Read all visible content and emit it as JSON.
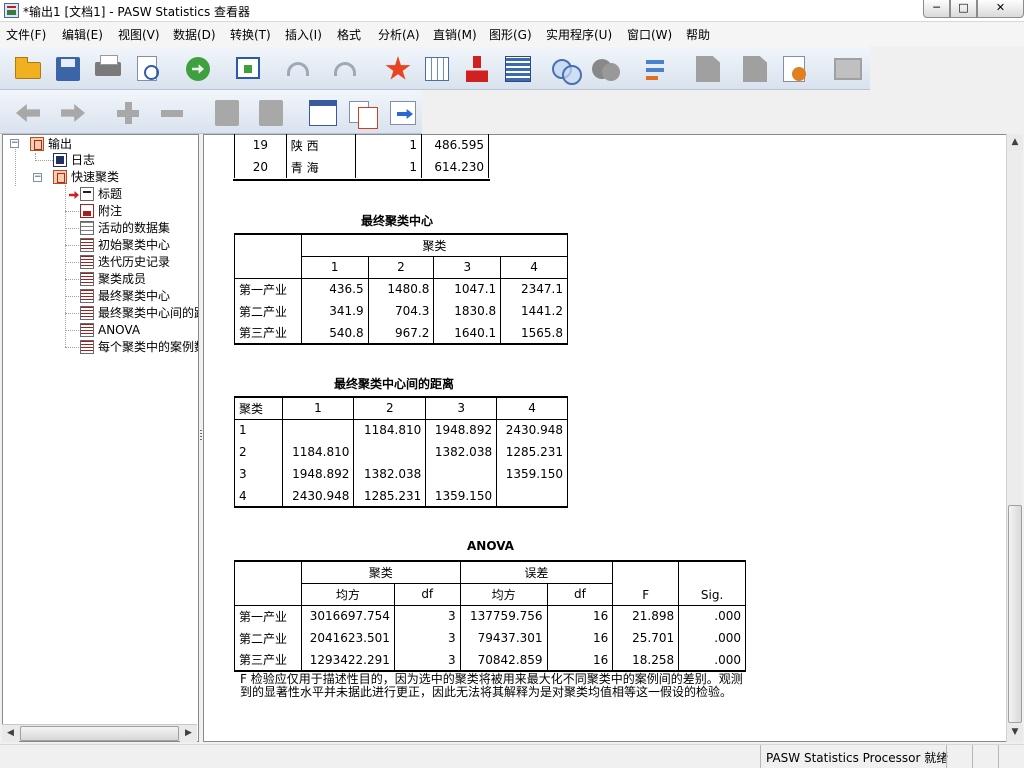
{
  "window": {
    "title": "*输出1 [文档1] - PASW Statistics 查看器",
    "min_glyph": "─",
    "max_glyph": "□",
    "close_glyph": "✕"
  },
  "menu": [
    "文件(F)",
    "编辑(E)",
    "视图(V)",
    "数据(D)",
    "转换(T)",
    "插入(I)",
    "格式",
    "分析(A)",
    "直销(M)",
    "图形(G)",
    "实用程序(U)",
    "窗口(W)",
    "帮助"
  ],
  "toolbar1": [
    "open-icon",
    "save-icon",
    "print-icon",
    "print-preview-icon",
    "export-icon",
    "goto-data-icon",
    "undo-icon",
    "redo-icon",
    "goto-case-icon",
    "variables-icon",
    "insert-cases-icon",
    "insert-variable-icon",
    "split-file-icon",
    "select-cases-icon",
    "value-labels-icon",
    "use-sets-icon",
    "show-all-variables-icon",
    "spelling-icon",
    "run-script-icon",
    "designate-window-icon"
  ],
  "toolbar2": [
    "promote-icon",
    "demote-icon",
    "expand-icon",
    "collapse-icon",
    "show-icon",
    "hide-icon",
    "insert-heading-icon",
    "insert-title-icon",
    "insert-text-icon"
  ],
  "outline": {
    "root": "输出",
    "log": "日志",
    "section": "快速聚类",
    "items": [
      "标题",
      "附注",
      "活动的数据集",
      "初始聚类中心",
      "迭代历史记录",
      "聚类成员",
      "最终聚类中心",
      "最终聚类中心间的距",
      "ANOVA",
      "每个聚类中的案例数"
    ]
  },
  "members_partial": {
    "rows": [
      {
        "case": "19",
        "province": "陕 西",
        "cluster": "1",
        "distance": "486.595"
      },
      {
        "case": "20",
        "province": "青 海",
        "cluster": "1",
        "distance": "614.230"
      }
    ]
  },
  "final_centers": {
    "title": "最终聚类中心",
    "group_header": "聚类",
    "columns": [
      "1",
      "2",
      "3",
      "4"
    ],
    "rows": [
      {
        "label": "第一产业",
        "values": [
          "436.5",
          "1480.8",
          "1047.1",
          "2347.1"
        ]
      },
      {
        "label": "第二产业",
        "values": [
          "341.9",
          "704.3",
          "1830.8",
          "1441.2"
        ]
      },
      {
        "label": "第三产业",
        "values": [
          "540.8",
          "967.2",
          "1640.1",
          "1565.8"
        ]
      }
    ]
  },
  "distances": {
    "title": "最终聚类中心间的距离",
    "corner": "聚类",
    "columns": [
      "1",
      "2",
      "3",
      "4"
    ],
    "rows": [
      {
        "label": "1",
        "values": [
          "",
          "1184.810",
          "1948.892",
          "2430.948"
        ]
      },
      {
        "label": "2",
        "values": [
          "1184.810",
          "",
          "1382.038",
          "1285.231"
        ]
      },
      {
        "label": "3",
        "values": [
          "1948.892",
          "1382.038",
          "",
          "1359.150"
        ]
      },
      {
        "label": "4",
        "values": [
          "2430.948",
          "1285.231",
          "1359.150",
          ""
        ]
      }
    ]
  },
  "anova": {
    "title": "ANOVA",
    "group1": "聚类",
    "group2": "误差",
    "sub_ms": "均方",
    "sub_df": "df",
    "col_f": "F",
    "col_sig": "Sig.",
    "rows": [
      {
        "label": "第一产业",
        "ms1": "3016697.754",
        "df1": "3",
        "ms2": "137759.756",
        "df2": "16",
        "f": "21.898",
        "sig": ".000"
      },
      {
        "label": "第二产业",
        "ms1": "2041623.501",
        "df1": "3",
        "ms2": "79437.301",
        "df2": "16",
        "f": "25.701",
        "sig": ".000"
      },
      {
        "label": "第三产业",
        "ms1": "1293422.291",
        "df1": "3",
        "ms2": "70842.859",
        "df2": "16",
        "f": "18.258",
        "sig": ".000"
      }
    ],
    "footnote": "F 检验应仅用于描述性目的，因为选中的聚类将被用来最大化不同聚类中的案例间的差别。观测到的显著性水平并未据此进行更正，因此无法将其解释为是对聚类均值相等这一假设的检验。"
  },
  "status": {
    "text": "PASW Statistics Processor 就绪"
  },
  "scroll": {
    "up": "▲",
    "down": "▼",
    "left": "◀",
    "right": "▶"
  }
}
